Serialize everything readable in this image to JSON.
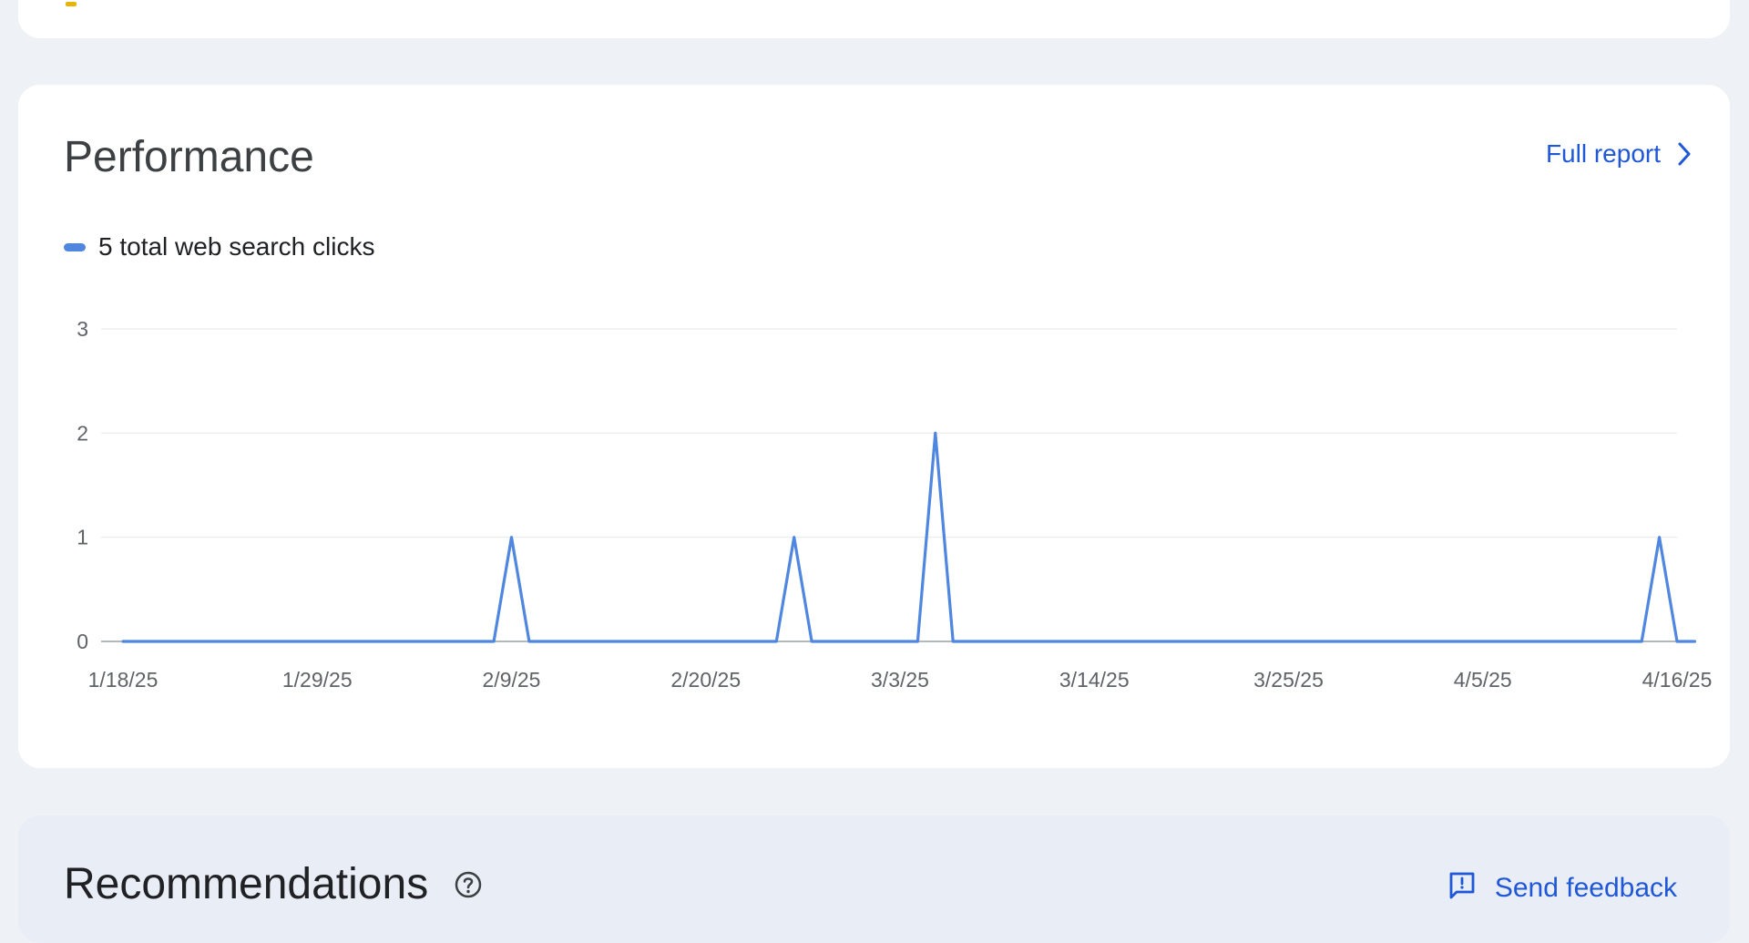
{
  "performance": {
    "title": "Performance",
    "full_report_label": "Full report",
    "legend_label": "5 total web search clicks"
  },
  "recommendations": {
    "title": "Recommendations",
    "send_feedback_label": "Send feedback"
  },
  "colors": {
    "series_line": "#4f86e0",
    "link": "#1f57d6",
    "grid": "#e8eaed",
    "baseline": "#9aa0a6"
  },
  "icons": {
    "full_report": "chevron-right-icon",
    "help": "help-circle-icon",
    "feedback": "feedback-icon"
  },
  "chart_data": {
    "type": "line",
    "grid": true,
    "legend_position": "top-left",
    "y_ticks": [
      "0",
      "1",
      "2",
      "3"
    ],
    "ylim": [
      0,
      3
    ],
    "x_tick_labels": [
      "1/18/25",
      "1/29/25",
      "2/9/25",
      "2/20/25",
      "3/3/25",
      "3/14/25",
      "3/25/25",
      "4/5/25",
      "4/16/25"
    ],
    "series": [
      {
        "name": "5 total web search clicks",
        "points": [
          {
            "date": "1/18/25",
            "value": 0
          },
          {
            "date": "2/8/25",
            "value": 0
          },
          {
            "date": "2/9/25",
            "value": 1
          },
          {
            "date": "2/10/25",
            "value": 0
          },
          {
            "date": "2/24/25",
            "value": 0
          },
          {
            "date": "2/25/25",
            "value": 1
          },
          {
            "date": "2/26/25",
            "value": 0
          },
          {
            "date": "3/4/25",
            "value": 0
          },
          {
            "date": "3/5/25",
            "value": 2
          },
          {
            "date": "3/6/25",
            "value": 0
          },
          {
            "date": "4/14/25",
            "value": 0
          },
          {
            "date": "4/15/25",
            "value": 1
          },
          {
            "date": "4/16/25",
            "value": 0
          },
          {
            "date": "4/17/25",
            "value": 0
          }
        ]
      }
    ]
  }
}
